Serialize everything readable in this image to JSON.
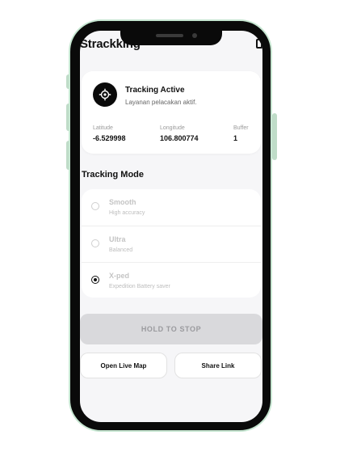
{
  "app": {
    "title": "Strackking"
  },
  "status_card": {
    "title": "Tracking Active",
    "subtitle": "Layanan pelacakan aktif.",
    "stats": [
      {
        "label": "Latitude",
        "value": "-6.529998"
      },
      {
        "label": "Longitude",
        "value": "106.800774"
      },
      {
        "label": "Buffer",
        "value": "1"
      }
    ]
  },
  "tracking_mode": {
    "title": "Tracking Mode",
    "options": [
      {
        "name": "Smooth",
        "desc": "High accuracy",
        "selected": false
      },
      {
        "name": "Ultra",
        "desc": "Balanced",
        "selected": false
      },
      {
        "name": "X-ped",
        "desc": "Expedition Battery saver",
        "selected": true
      }
    ]
  },
  "actions": {
    "hold_label": "HOLD TO STOP",
    "map_label": "Open Live Map",
    "share_label": "Share Link"
  },
  "icons": {
    "status": "target-icon",
    "top_right": "device-icon"
  },
  "colors": {
    "accent": "#0a0a0a",
    "frame": "#c6e6d1",
    "disabled": "#d9d9dc"
  }
}
